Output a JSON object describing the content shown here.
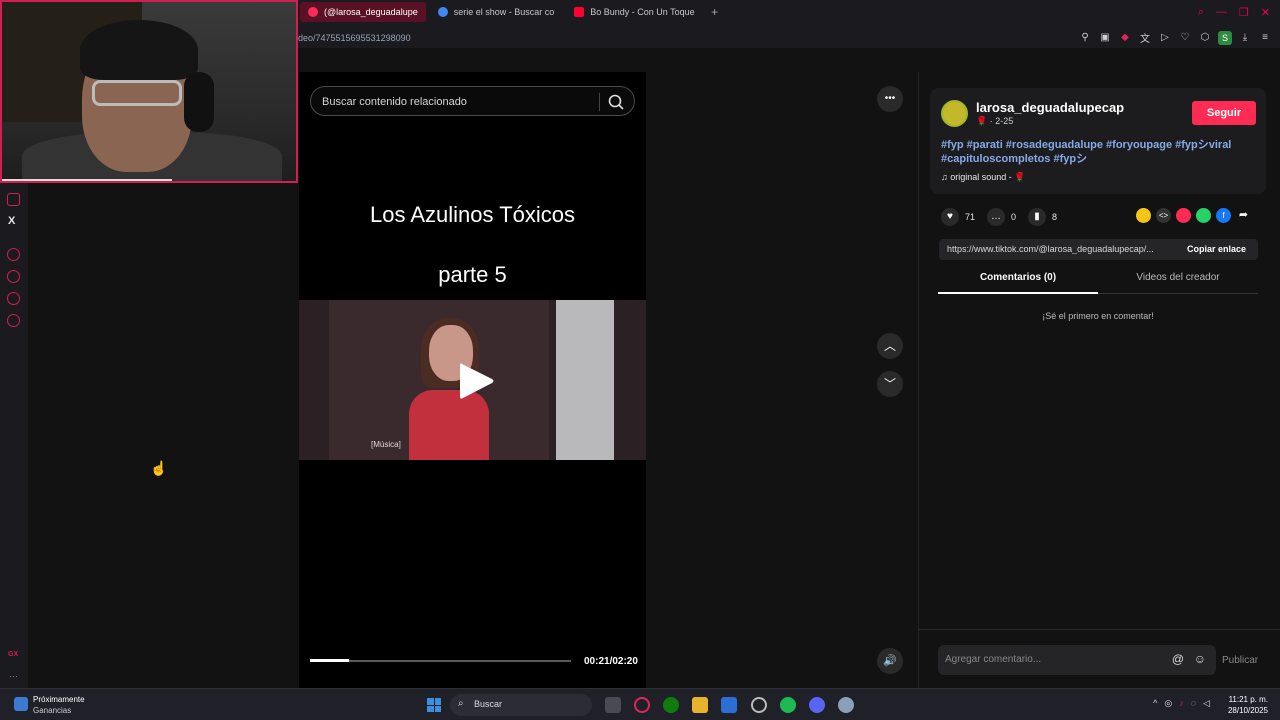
{
  "browser": {
    "tabs": [
      {
        "label": "(@larosa_deguadalupe",
        "active": true,
        "icon": "tiktok-icon",
        "color": "#fe2c55"
      },
      {
        "label": "serie el show - Buscar co",
        "active": false,
        "icon": "google-icon",
        "color": "#4285f4"
      },
      {
        "label": "Bo Bundy - Con Un Toque",
        "active": false,
        "icon": "youtube-icon",
        "color": "#ff0033"
      }
    ],
    "new_tab": "+",
    "url": "deo/7475515695531298090"
  },
  "left_sidebar": {
    "x_label": "X",
    "gx_label": "GX",
    "more": "···"
  },
  "video": {
    "search_placeholder": "Buscar contenido relacionado",
    "title": "Los Azulinos Tóxicos",
    "subtitle": "parte 5",
    "caption": "[Música]",
    "progress": 0.15,
    "time": "00:21/02:20"
  },
  "nav": {
    "more": "•••",
    "up": "︿",
    "down": "﹀",
    "volume": "🔊"
  },
  "post": {
    "username": "larosa_deguadalupecap",
    "date": "🌹 · 2-25",
    "follow": "Seguir",
    "tags": "#fyp #parati #rosadeguadalupe #foryoupage #fypシviral #capituloscompletos #fypシ",
    "sound": "♫  original sound - 🌹",
    "likes": "71",
    "comments": "0",
    "saves": "8",
    "link": "https://www.tiktok.com/@larosa_deguadalupecap/...",
    "copy": "Copiar enlace",
    "tab_comments": "Comentarios (0)",
    "tab_creator": "Videos del creador",
    "empty": "¡Sé el primero en comentar!",
    "comment_placeholder": "Agregar comentario...",
    "publish": "Publicar",
    "brand_color": "#fe2c55"
  },
  "taskbar": {
    "widget_title": "Próximamente",
    "widget_sub": "Ganancias",
    "search": "Buscar",
    "time": "11:21 p. m.",
    "date": "28/10/2025"
  }
}
